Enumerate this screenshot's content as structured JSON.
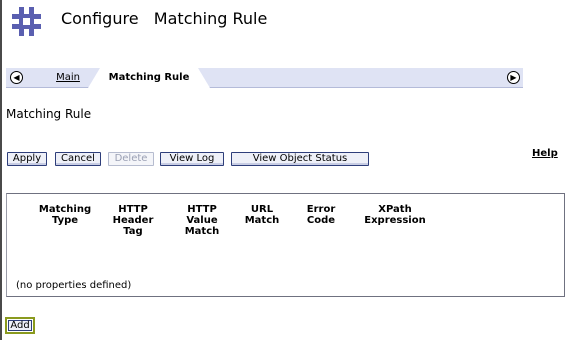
{
  "header": {
    "title": "Configure   Matching Rule",
    "logo_icon": "hash-grid-logo",
    "logo_color": "#5a5fb0"
  },
  "tabs": {
    "items": [
      {
        "label": "Main",
        "active": false
      },
      {
        "label": "Matching Rule",
        "active": true
      }
    ],
    "left_arrow_icon": "arrow-left-circle-icon",
    "right_arrow_icon": "arrow-right-circle-icon"
  },
  "section": {
    "title": "Matching Rule"
  },
  "toolbar": {
    "apply": "Apply",
    "cancel": "Cancel",
    "delete": "Delete",
    "view_log": "View Log",
    "view_object_status": "View Object Status",
    "help": "Help"
  },
  "table": {
    "columns": [
      "Matching\nType",
      "HTTP\nHeader\nTag",
      "HTTP\nValue\nMatch",
      "URL\nMatch",
      "Error\nCode",
      "XPath\nExpression"
    ],
    "empty_message": "(no properties defined)"
  },
  "add_button": "Add"
}
